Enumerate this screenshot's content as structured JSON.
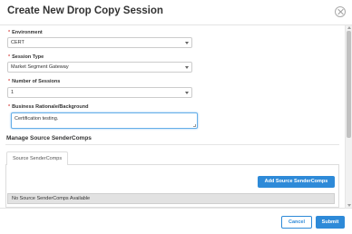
{
  "dialog": {
    "title": "Create New Drop Copy Session"
  },
  "form": {
    "required_marker": "*",
    "environment": {
      "label": "Environment",
      "value": "CERT"
    },
    "session_type": {
      "label": "Session Type",
      "value": "Market Segment Gateway"
    },
    "number_of_sessions": {
      "label": "Number of Sessions",
      "value": "1"
    },
    "business_rationale": {
      "label": "Business Rationale/Background",
      "value": "Certification testing."
    }
  },
  "sender_comps": {
    "section_title": "Manage Source SenderComps",
    "tab_label": "Source SenderComps",
    "add_button_label": "Add Source SenderComps",
    "empty_message": "No Source SenderComps Available"
  },
  "footer": {
    "cancel_label": "Cancel",
    "submit_label": "Submit"
  },
  "colors": {
    "accent": "#2e8ad8",
    "required": "#d9534f",
    "empty_row_bg": "#e2e2e2"
  },
  "icons": {
    "close": "close-circle-icon",
    "select_arrow": "chevron-down-icon"
  }
}
